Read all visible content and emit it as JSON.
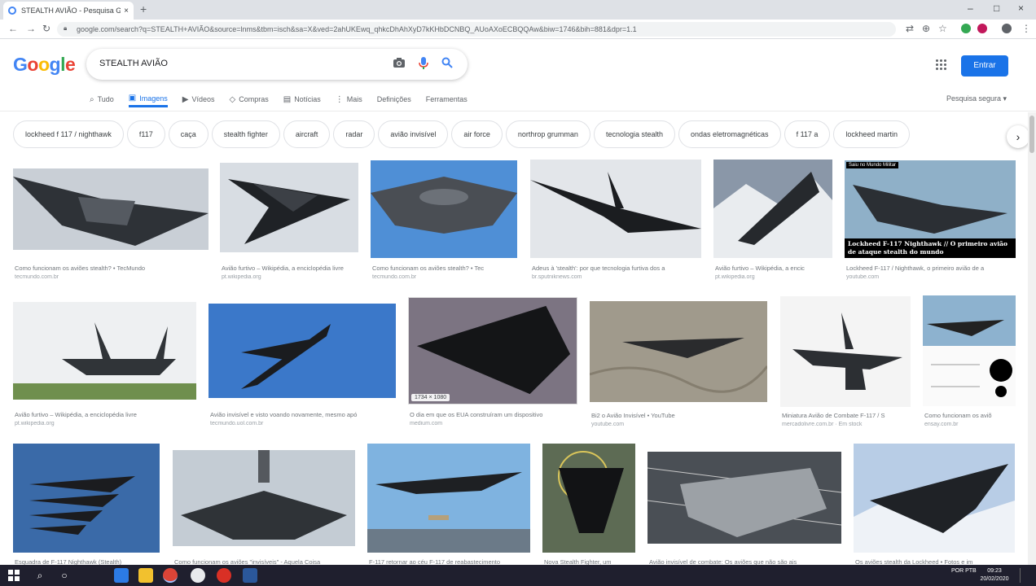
{
  "browser": {
    "tab_title": "STEALTH AVIÃO - Pesquisa Goo",
    "tab_close": "×",
    "new_tab": "+",
    "url": "google.com/search?q=STEALTH+AVIÃO&source=lnms&tbm=isch&sa=X&ved=2ahUKEwq_qhkcDhAhXyD7kKHbDCNBQ_AUoAXoECBQQAw&biw=1746&bih=881&dpr=1.1",
    "window_controls": [
      "–",
      "□",
      "×"
    ]
  },
  "header": {
    "logo_letters": [
      "G",
      "o",
      "o",
      "g",
      "l",
      "e"
    ],
    "logo_colors": [
      "#4285f4",
      "#ea4335",
      "#fbbc05",
      "#4285f4",
      "#34a853",
      "#ea4335"
    ],
    "query": "STEALTH AVIÃO",
    "signin_label": "Entrar"
  },
  "nav": {
    "items": [
      {
        "icon": "⌕",
        "label": "Tudo"
      },
      {
        "icon": "▣",
        "label": "Imagens"
      },
      {
        "icon": "▶",
        "label": "Vídeos"
      },
      {
        "icon": "◇",
        "label": "Compras"
      },
      {
        "icon": "▤",
        "label": "Notícias"
      },
      {
        "icon": "⋮",
        "label": "Mais"
      },
      {
        "icon": "",
        "label": "Definições"
      },
      {
        "icon": "",
        "label": "Ferramentas"
      }
    ],
    "active_index": 1,
    "safe_search": "Pesquisa segura ▾"
  },
  "chips": [
    "lockheed f 117 / nighthawk",
    "f117",
    "caça",
    "stealth fighter",
    "aircraft",
    "radar",
    "avião invisível",
    "air force",
    "northrop grumman",
    "tecnologia stealth",
    "ondas eletromagnéticas",
    "f 117 a",
    "lockheed martin"
  ],
  "results": [
    {
      "caption": "Como funcionam os aviões stealth? • TecMundo",
      "source": "tecmundo.com.br"
    },
    {
      "caption": "Avião furtivo – Wikipédia, a enciclopédia livre",
      "source": "pt.wikipedia.org"
    },
    {
      "caption": "Como funcionam os aviões stealth? • Tec",
      "source": "tecmundo.com.br"
    },
    {
      "caption": "Adeus à 'stealth': por que tecnologia furtiva dos a",
      "source": "br.sputniknews.com"
    },
    {
      "caption": "Avião furtivo – Wikipédia, a encic",
      "source": "pt.wikipedia.org"
    },
    {
      "caption": "Lockheed F-117 / Nighthawk, o primeiro avião de a",
      "source": "youtube.com",
      "overlay_top": "Saiu no Mundo Militar",
      "overlay_bottom": "Lockheed F-117 Nighthawk // O primeiro avião de ataque stealth do mundo"
    },
    {
      "caption": "Avião furtivo – Wikipédia, a enciclopédia livre",
      "source": "pt.wikipedia.org"
    },
    {
      "caption": "Avião invisível e visto voando novamente, mesmo apó",
      "source": "tecmundo.uol.com.br"
    },
    {
      "caption": "O dia em que os EUA construíram um dispositivo",
      "source": "medium.com",
      "badge": "1734 × 1080"
    },
    {
      "caption": "Bi2 o Avião Invisível • YouTube",
      "source": "youtube.com"
    },
    {
      "caption": "Miniatura Avião de Combate F-117 / S",
      "source": "mercadolivre.com.br · Em stock"
    },
    {
      "caption": "Como funcionam os aviõ",
      "source": "ensay.com.br"
    },
    {
      "caption": "Esquadra de F-117 Nighthawk (Stealth)",
      "source": ""
    },
    {
      "caption": "Como funcionam os aviões \"invisíveis\" - Aquela Coisa",
      "source": ""
    },
    {
      "caption": "F-117 retornar ao céu F-117 de reabastecimento",
      "source": ""
    },
    {
      "caption": "Nova Stealth Fighter, um",
      "source": ""
    },
    {
      "caption": "Avião invisível de combate: Os aviões que não são ais",
      "source": ""
    },
    {
      "caption": "Os aviões stealth da Lockheed • Fotos e im",
      "source": ""
    }
  ],
  "taskbar": {
    "lang": "POR PTB",
    "time": "09:23",
    "date": "20/02/2020"
  }
}
